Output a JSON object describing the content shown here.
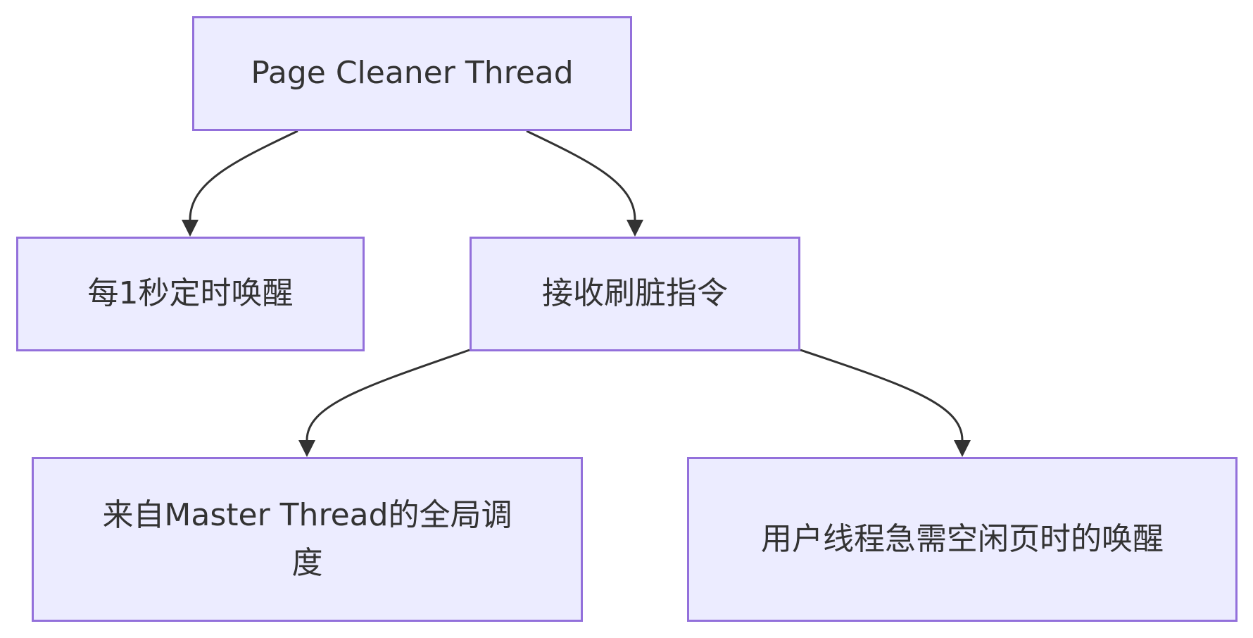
{
  "nodes": {
    "root": "Page Cleaner Thread",
    "timer": "每1秒定时唤醒",
    "cmd": "接收刷脏指令",
    "master": "来自Master Thread的全局调度",
    "user": "用户线程急需空闲页时的唤醒"
  },
  "colors": {
    "node_fill": "#ececff",
    "node_border": "#9370db",
    "edge": "#333333",
    "text": "#333333"
  }
}
